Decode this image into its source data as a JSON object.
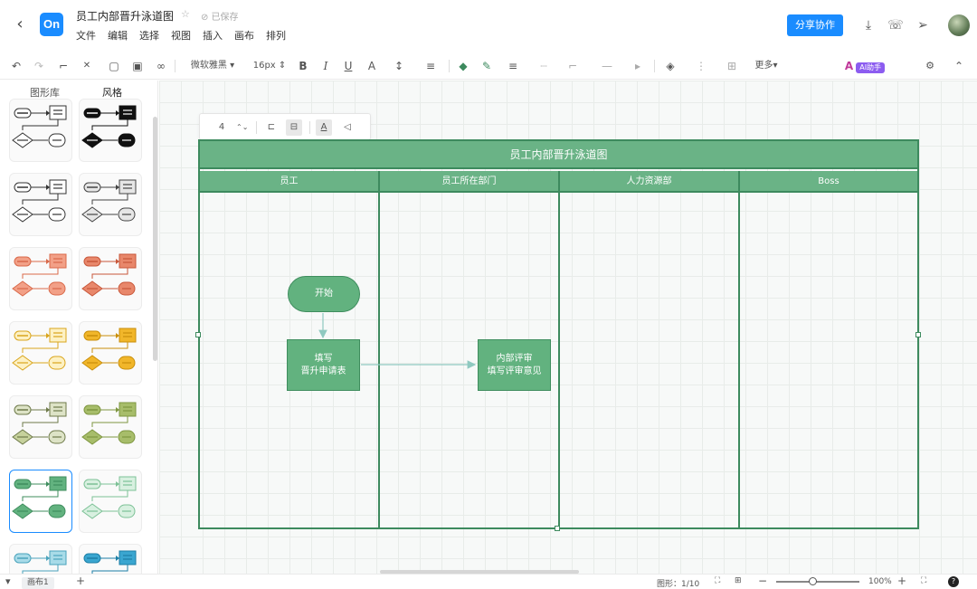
{
  "header": {
    "back_icon": "‹",
    "logo_text": "On",
    "doc_title": "员工内部晋升泳道图",
    "star_icon": "☆",
    "saved_status": "⊘ 已保存",
    "menus": [
      "文件",
      "编辑",
      "选择",
      "视图",
      "插入",
      "画布",
      "排列"
    ],
    "share_label": "分享协作",
    "download_icon": "⤓",
    "phone_icon": "☏",
    "send_icon": "➢"
  },
  "toolbar": {
    "undo": "↶",
    "redo": "↷",
    "format_painter": "⌐",
    "clear_format": "✕",
    "fill_shape": "▢",
    "image": "▣",
    "link": "∞",
    "font": "微软雅黑",
    "font_size": "16px",
    "bold": "B",
    "italic": "I",
    "underline": "U",
    "font_color": "A",
    "line_height": "↕",
    "align": "≡",
    "fill_color": "◆",
    "line_color": "✎",
    "line_style": "≡",
    "dash": "┈",
    "connector": "⌐",
    "line_end": "—",
    "arrow": "▸",
    "layers": "◈",
    "arrange": "⋮",
    "table": "⊞",
    "more": "更多",
    "ai_label": "AI助手",
    "ai_icon": "A",
    "settings": "⚙",
    "collapse": "⌃"
  },
  "left_panel": {
    "tabs": [
      "图形库",
      "风格"
    ],
    "active_tab": "风格",
    "styles": [
      {
        "fill": "#ffffff",
        "stroke": "#333333",
        "accent": "#333333",
        "start_fill": "#ffffff",
        "diamond": "#ffffff"
      },
      {
        "fill": "#111111",
        "stroke": "#111111",
        "accent": "#111111",
        "start_fill": "#111111",
        "diamond": "#111111"
      },
      {
        "fill": "#ffffff",
        "stroke": "#333333",
        "accent": "#333333",
        "start_fill": "#ffffff",
        "diamond": "#ffffff"
      },
      {
        "fill": "#e6e6e6",
        "stroke": "#444444",
        "accent": "#444444",
        "start_fill": "#e6e6e6",
        "diamond": "#e6e6e6"
      },
      {
        "fill": "#f2a087",
        "stroke": "#d9694a",
        "accent": "#d9694a",
        "start_fill": "#f2a087",
        "diamond": "#f2a087"
      },
      {
        "fill": "#e8876b",
        "stroke": "#c8573a",
        "accent": "#c8573a",
        "start_fill": "#e8876b",
        "diamond": "#e8876b"
      },
      {
        "fill": "#fdf1c3",
        "stroke": "#d9a51c",
        "accent": "#d9a51c",
        "start_fill": "#fdf1c3",
        "diamond": "#fdf1c3"
      },
      {
        "fill": "#f1b62a",
        "stroke": "#c98f0b",
        "accent": "#c98f0b",
        "start_fill": "#f1b62a",
        "diamond": "#f1b62a"
      },
      {
        "fill": "#dde3c6",
        "stroke": "#6e7a4a",
        "accent": "#6e7a4a",
        "start_fill": "#dde3c6",
        "diamond": "#c6d19c"
      },
      {
        "fill": "#a7bd6a",
        "stroke": "#7e9640",
        "accent": "#7e9640",
        "start_fill": "#a7bd6a",
        "diamond": "#a7bd6a"
      },
      {
        "fill": "#62b27f",
        "stroke": "#3f8d5e",
        "accent": "#3f8d5e",
        "start_fill": "#62b27f",
        "diamond": "#62b27f"
      },
      {
        "fill": "#d8f0e0",
        "stroke": "#7cc196",
        "accent": "#7cc196",
        "start_fill": "#d8f0e0",
        "diamond": "#d8f0e0"
      },
      {
        "fill": "#a8dbe8",
        "stroke": "#4aa3bc",
        "accent": "#4aa3bc",
        "start_fill": "#a8dbe8",
        "diamond": "#a8dbe8"
      },
      {
        "fill": "#3aa6d0",
        "stroke": "#1c7fa6",
        "accent": "#1c7fa6",
        "start_fill": "#3aa6d0",
        "diamond": "#3aa6d0"
      }
    ],
    "selected_style_index": 10
  },
  "float_toolbar": {
    "value": "4",
    "stepper": "⌃⌄",
    "align_left_icon": "⊏",
    "align_center_icon": "⊟",
    "text_icon": "A",
    "text_dir_icon": "◁"
  },
  "diagram": {
    "pool_title": "员工内部晋升泳道图",
    "lanes": [
      "员工",
      "员工所在部门",
      "人力资源部",
      "Boss"
    ],
    "start_label": "开始",
    "fill_form_lines": [
      "填写",
      "晋升申请表"
    ],
    "review_lines": [
      "内部评审",
      "填写评审意见"
    ],
    "colors": {
      "lane_fill": "#6ab386",
      "border": "#3d8a5e",
      "node_fill": "#62b27f",
      "connector": "#8fc9c0"
    }
  },
  "statusbar": {
    "page_tab": "画布1",
    "add_page": "+",
    "shape_count": "图形：1/10",
    "fit_icon": "⛶",
    "map_icon": "⊞",
    "zoom_out": "−",
    "zoom": "100%",
    "zoom_in": "+",
    "fullscreen": "⛶",
    "help": "?"
  }
}
